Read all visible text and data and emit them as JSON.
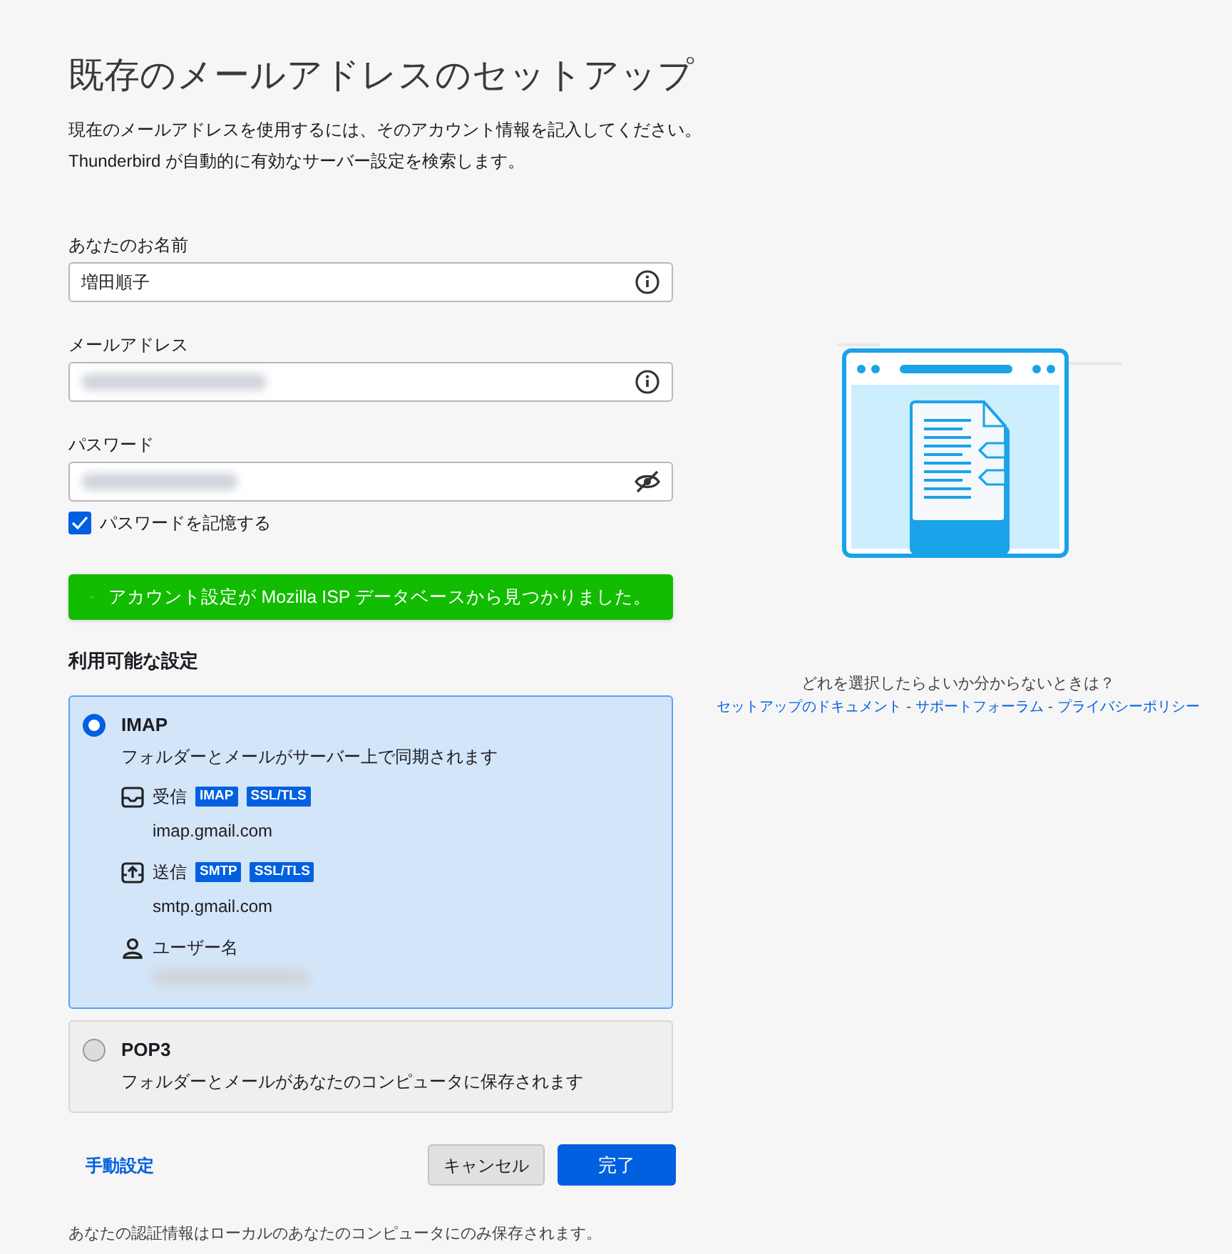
{
  "title": "既存のメールアドレスのセットアップ",
  "intro": [
    "現在のメールアドレスを使用するには、そのアカウント情報を記入してください。",
    "Thunderbird が自動的に有効なサーバー設定を検索します。"
  ],
  "fields": [
    {
      "label": "あなたのお名前",
      "value": "増田順子",
      "kind": "info"
    },
    {
      "label": "メールアドレス",
      "kind": "info",
      "blurred": true
    },
    {
      "label": "パスワード",
      "kind": "password",
      "blurred": true
    }
  ],
  "remember_password": {
    "label": "パスワードを記憶する",
    "checked": true
  },
  "notice": "アカウント設定が Mozilla ISP データベースから見つかりました。",
  "configs_heading": "利用可能な設定",
  "configs": [
    {
      "name": "IMAP",
      "description": "フォルダーとメールがサーバー上で同期されます",
      "selected": true,
      "servers": [
        {
          "kind": "incoming",
          "label": "受信",
          "tags": [
            "IMAP",
            "SSL/TLS"
          ],
          "host": "imap.gmail.com"
        },
        {
          "kind": "outgoing",
          "label": "送信",
          "tags": [
            "SMTP",
            "SSL/TLS"
          ],
          "host": "smtp.gmail.com"
        },
        {
          "kind": "user",
          "label": "ユーザー名",
          "blurred": true
        }
      ]
    },
    {
      "name": "POP3",
      "description": "フォルダーとメールがあなたのコンピュータに保存されます",
      "selected": false
    }
  ],
  "manual_link": "手動設定",
  "buttons": {
    "cancel": "キャンセル",
    "done": "完了"
  },
  "footer": "あなたの認証情報はローカルのあなたのコンピュータにのみ保存されます。",
  "help": {
    "question": "どれを選択したらよいか分からないときは？",
    "links": [
      "セットアップのドキュメント",
      "サポートフォーラム",
      "プライバシーポリシー"
    ],
    "separator": "-"
  }
}
